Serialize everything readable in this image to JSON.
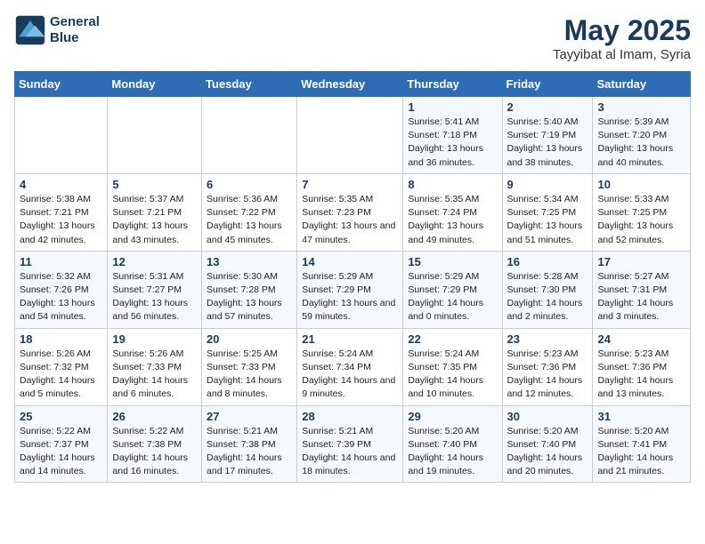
{
  "logo": {
    "line1": "General",
    "line2": "Blue"
  },
  "title": "May 2025",
  "location": "Tayyibat al Imam, Syria",
  "days_header": [
    "Sunday",
    "Monday",
    "Tuesday",
    "Wednesday",
    "Thursday",
    "Friday",
    "Saturday"
  ],
  "weeks": [
    [
      {
        "day": "",
        "sunrise": "",
        "sunset": "",
        "daylight": ""
      },
      {
        "day": "",
        "sunrise": "",
        "sunset": "",
        "daylight": ""
      },
      {
        "day": "",
        "sunrise": "",
        "sunset": "",
        "daylight": ""
      },
      {
        "day": "",
        "sunrise": "",
        "sunset": "",
        "daylight": ""
      },
      {
        "day": "1",
        "sunrise": "Sunrise: 5:41 AM",
        "sunset": "Sunset: 7:18 PM",
        "daylight": "Daylight: 13 hours and 36 minutes."
      },
      {
        "day": "2",
        "sunrise": "Sunrise: 5:40 AM",
        "sunset": "Sunset: 7:19 PM",
        "daylight": "Daylight: 13 hours and 38 minutes."
      },
      {
        "day": "3",
        "sunrise": "Sunrise: 5:39 AM",
        "sunset": "Sunset: 7:20 PM",
        "daylight": "Daylight: 13 hours and 40 minutes."
      }
    ],
    [
      {
        "day": "4",
        "sunrise": "Sunrise: 5:38 AM",
        "sunset": "Sunset: 7:21 PM",
        "daylight": "Daylight: 13 hours and 42 minutes."
      },
      {
        "day": "5",
        "sunrise": "Sunrise: 5:37 AM",
        "sunset": "Sunset: 7:21 PM",
        "daylight": "Daylight: 13 hours and 43 minutes."
      },
      {
        "day": "6",
        "sunrise": "Sunrise: 5:36 AM",
        "sunset": "Sunset: 7:22 PM",
        "daylight": "Daylight: 13 hours and 45 minutes."
      },
      {
        "day": "7",
        "sunrise": "Sunrise: 5:35 AM",
        "sunset": "Sunset: 7:23 PM",
        "daylight": "Daylight: 13 hours and 47 minutes."
      },
      {
        "day": "8",
        "sunrise": "Sunrise: 5:35 AM",
        "sunset": "Sunset: 7:24 PM",
        "daylight": "Daylight: 13 hours and 49 minutes."
      },
      {
        "day": "9",
        "sunrise": "Sunrise: 5:34 AM",
        "sunset": "Sunset: 7:25 PM",
        "daylight": "Daylight: 13 hours and 51 minutes."
      },
      {
        "day": "10",
        "sunrise": "Sunrise: 5:33 AM",
        "sunset": "Sunset: 7:25 PM",
        "daylight": "Daylight: 13 hours and 52 minutes."
      }
    ],
    [
      {
        "day": "11",
        "sunrise": "Sunrise: 5:32 AM",
        "sunset": "Sunset: 7:26 PM",
        "daylight": "Daylight: 13 hours and 54 minutes."
      },
      {
        "day": "12",
        "sunrise": "Sunrise: 5:31 AM",
        "sunset": "Sunset: 7:27 PM",
        "daylight": "Daylight: 13 hours and 56 minutes."
      },
      {
        "day": "13",
        "sunrise": "Sunrise: 5:30 AM",
        "sunset": "Sunset: 7:28 PM",
        "daylight": "Daylight: 13 hours and 57 minutes."
      },
      {
        "day": "14",
        "sunrise": "Sunrise: 5:29 AM",
        "sunset": "Sunset: 7:29 PM",
        "daylight": "Daylight: 13 hours and 59 minutes."
      },
      {
        "day": "15",
        "sunrise": "Sunrise: 5:29 AM",
        "sunset": "Sunset: 7:29 PM",
        "daylight": "Daylight: 14 hours and 0 minutes."
      },
      {
        "day": "16",
        "sunrise": "Sunrise: 5:28 AM",
        "sunset": "Sunset: 7:30 PM",
        "daylight": "Daylight: 14 hours and 2 minutes."
      },
      {
        "day": "17",
        "sunrise": "Sunrise: 5:27 AM",
        "sunset": "Sunset: 7:31 PM",
        "daylight": "Daylight: 14 hours and 3 minutes."
      }
    ],
    [
      {
        "day": "18",
        "sunrise": "Sunrise: 5:26 AM",
        "sunset": "Sunset: 7:32 PM",
        "daylight": "Daylight: 14 hours and 5 minutes."
      },
      {
        "day": "19",
        "sunrise": "Sunrise: 5:26 AM",
        "sunset": "Sunset: 7:33 PM",
        "daylight": "Daylight: 14 hours and 6 minutes."
      },
      {
        "day": "20",
        "sunrise": "Sunrise: 5:25 AM",
        "sunset": "Sunset: 7:33 PM",
        "daylight": "Daylight: 14 hours and 8 minutes."
      },
      {
        "day": "21",
        "sunrise": "Sunrise: 5:24 AM",
        "sunset": "Sunset: 7:34 PM",
        "daylight": "Daylight: 14 hours and 9 minutes."
      },
      {
        "day": "22",
        "sunrise": "Sunrise: 5:24 AM",
        "sunset": "Sunset: 7:35 PM",
        "daylight": "Daylight: 14 hours and 10 minutes."
      },
      {
        "day": "23",
        "sunrise": "Sunrise: 5:23 AM",
        "sunset": "Sunset: 7:36 PM",
        "daylight": "Daylight: 14 hours and 12 minutes."
      },
      {
        "day": "24",
        "sunrise": "Sunrise: 5:23 AM",
        "sunset": "Sunset: 7:36 PM",
        "daylight": "Daylight: 14 hours and 13 minutes."
      }
    ],
    [
      {
        "day": "25",
        "sunrise": "Sunrise: 5:22 AM",
        "sunset": "Sunset: 7:37 PM",
        "daylight": "Daylight: 14 hours and 14 minutes."
      },
      {
        "day": "26",
        "sunrise": "Sunrise: 5:22 AM",
        "sunset": "Sunset: 7:38 PM",
        "daylight": "Daylight: 14 hours and 16 minutes."
      },
      {
        "day": "27",
        "sunrise": "Sunrise: 5:21 AM",
        "sunset": "Sunset: 7:38 PM",
        "daylight": "Daylight: 14 hours and 17 minutes."
      },
      {
        "day": "28",
        "sunrise": "Sunrise: 5:21 AM",
        "sunset": "Sunset: 7:39 PM",
        "daylight": "Daylight: 14 hours and 18 minutes."
      },
      {
        "day": "29",
        "sunrise": "Sunrise: 5:20 AM",
        "sunset": "Sunset: 7:40 PM",
        "daylight": "Daylight: 14 hours and 19 minutes."
      },
      {
        "day": "30",
        "sunrise": "Sunrise: 5:20 AM",
        "sunset": "Sunset: 7:40 PM",
        "daylight": "Daylight: 14 hours and 20 minutes."
      },
      {
        "day": "31",
        "sunrise": "Sunrise: 5:20 AM",
        "sunset": "Sunset: 7:41 PM",
        "daylight": "Daylight: 14 hours and 21 minutes."
      }
    ]
  ]
}
